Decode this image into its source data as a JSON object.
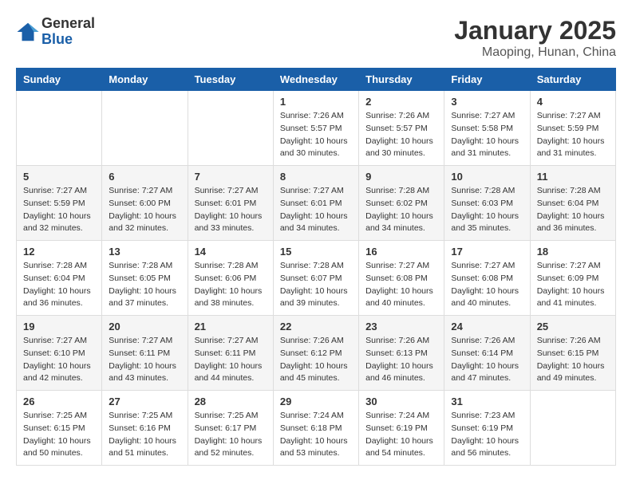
{
  "header": {
    "logo_general": "General",
    "logo_blue": "Blue",
    "month": "January 2025",
    "location": "Maoping, Hunan, China"
  },
  "weekdays": [
    "Sunday",
    "Monday",
    "Tuesday",
    "Wednesday",
    "Thursday",
    "Friday",
    "Saturday"
  ],
  "weeks": [
    [
      {
        "day": "",
        "sunrise": "",
        "sunset": "",
        "daylight": ""
      },
      {
        "day": "",
        "sunrise": "",
        "sunset": "",
        "daylight": ""
      },
      {
        "day": "",
        "sunrise": "",
        "sunset": "",
        "daylight": ""
      },
      {
        "day": "1",
        "sunrise": "Sunrise: 7:26 AM",
        "sunset": "Sunset: 5:57 PM",
        "daylight": "Daylight: 10 hours and 30 minutes."
      },
      {
        "day": "2",
        "sunrise": "Sunrise: 7:26 AM",
        "sunset": "Sunset: 5:57 PM",
        "daylight": "Daylight: 10 hours and 30 minutes."
      },
      {
        "day": "3",
        "sunrise": "Sunrise: 7:27 AM",
        "sunset": "Sunset: 5:58 PM",
        "daylight": "Daylight: 10 hours and 31 minutes."
      },
      {
        "day": "4",
        "sunrise": "Sunrise: 7:27 AM",
        "sunset": "Sunset: 5:59 PM",
        "daylight": "Daylight: 10 hours and 31 minutes."
      }
    ],
    [
      {
        "day": "5",
        "sunrise": "Sunrise: 7:27 AM",
        "sunset": "Sunset: 5:59 PM",
        "daylight": "Daylight: 10 hours and 32 minutes."
      },
      {
        "day": "6",
        "sunrise": "Sunrise: 7:27 AM",
        "sunset": "Sunset: 6:00 PM",
        "daylight": "Daylight: 10 hours and 32 minutes."
      },
      {
        "day": "7",
        "sunrise": "Sunrise: 7:27 AM",
        "sunset": "Sunset: 6:01 PM",
        "daylight": "Daylight: 10 hours and 33 minutes."
      },
      {
        "day": "8",
        "sunrise": "Sunrise: 7:27 AM",
        "sunset": "Sunset: 6:01 PM",
        "daylight": "Daylight: 10 hours and 34 minutes."
      },
      {
        "day": "9",
        "sunrise": "Sunrise: 7:28 AM",
        "sunset": "Sunset: 6:02 PM",
        "daylight": "Daylight: 10 hours and 34 minutes."
      },
      {
        "day": "10",
        "sunrise": "Sunrise: 7:28 AM",
        "sunset": "Sunset: 6:03 PM",
        "daylight": "Daylight: 10 hours and 35 minutes."
      },
      {
        "day": "11",
        "sunrise": "Sunrise: 7:28 AM",
        "sunset": "Sunset: 6:04 PM",
        "daylight": "Daylight: 10 hours and 36 minutes."
      }
    ],
    [
      {
        "day": "12",
        "sunrise": "Sunrise: 7:28 AM",
        "sunset": "Sunset: 6:04 PM",
        "daylight": "Daylight: 10 hours and 36 minutes."
      },
      {
        "day": "13",
        "sunrise": "Sunrise: 7:28 AM",
        "sunset": "Sunset: 6:05 PM",
        "daylight": "Daylight: 10 hours and 37 minutes."
      },
      {
        "day": "14",
        "sunrise": "Sunrise: 7:28 AM",
        "sunset": "Sunset: 6:06 PM",
        "daylight": "Daylight: 10 hours and 38 minutes."
      },
      {
        "day": "15",
        "sunrise": "Sunrise: 7:28 AM",
        "sunset": "Sunset: 6:07 PM",
        "daylight": "Daylight: 10 hours and 39 minutes."
      },
      {
        "day": "16",
        "sunrise": "Sunrise: 7:27 AM",
        "sunset": "Sunset: 6:08 PM",
        "daylight": "Daylight: 10 hours and 40 minutes."
      },
      {
        "day": "17",
        "sunrise": "Sunrise: 7:27 AM",
        "sunset": "Sunset: 6:08 PM",
        "daylight": "Daylight: 10 hours and 40 minutes."
      },
      {
        "day": "18",
        "sunrise": "Sunrise: 7:27 AM",
        "sunset": "Sunset: 6:09 PM",
        "daylight": "Daylight: 10 hours and 41 minutes."
      }
    ],
    [
      {
        "day": "19",
        "sunrise": "Sunrise: 7:27 AM",
        "sunset": "Sunset: 6:10 PM",
        "daylight": "Daylight: 10 hours and 42 minutes."
      },
      {
        "day": "20",
        "sunrise": "Sunrise: 7:27 AM",
        "sunset": "Sunset: 6:11 PM",
        "daylight": "Daylight: 10 hours and 43 minutes."
      },
      {
        "day": "21",
        "sunrise": "Sunrise: 7:27 AM",
        "sunset": "Sunset: 6:11 PM",
        "daylight": "Daylight: 10 hours and 44 minutes."
      },
      {
        "day": "22",
        "sunrise": "Sunrise: 7:26 AM",
        "sunset": "Sunset: 6:12 PM",
        "daylight": "Daylight: 10 hours and 45 minutes."
      },
      {
        "day": "23",
        "sunrise": "Sunrise: 7:26 AM",
        "sunset": "Sunset: 6:13 PM",
        "daylight": "Daylight: 10 hours and 46 minutes."
      },
      {
        "day": "24",
        "sunrise": "Sunrise: 7:26 AM",
        "sunset": "Sunset: 6:14 PM",
        "daylight": "Daylight: 10 hours and 47 minutes."
      },
      {
        "day": "25",
        "sunrise": "Sunrise: 7:26 AM",
        "sunset": "Sunset: 6:15 PM",
        "daylight": "Daylight: 10 hours and 49 minutes."
      }
    ],
    [
      {
        "day": "26",
        "sunrise": "Sunrise: 7:25 AM",
        "sunset": "Sunset: 6:15 PM",
        "daylight": "Daylight: 10 hours and 50 minutes."
      },
      {
        "day": "27",
        "sunrise": "Sunrise: 7:25 AM",
        "sunset": "Sunset: 6:16 PM",
        "daylight": "Daylight: 10 hours and 51 minutes."
      },
      {
        "day": "28",
        "sunrise": "Sunrise: 7:25 AM",
        "sunset": "Sunset: 6:17 PM",
        "daylight": "Daylight: 10 hours and 52 minutes."
      },
      {
        "day": "29",
        "sunrise": "Sunrise: 7:24 AM",
        "sunset": "Sunset: 6:18 PM",
        "daylight": "Daylight: 10 hours and 53 minutes."
      },
      {
        "day": "30",
        "sunrise": "Sunrise: 7:24 AM",
        "sunset": "Sunset: 6:19 PM",
        "daylight": "Daylight: 10 hours and 54 minutes."
      },
      {
        "day": "31",
        "sunrise": "Sunrise: 7:23 AM",
        "sunset": "Sunset: 6:19 PM",
        "daylight": "Daylight: 10 hours and 56 minutes."
      },
      {
        "day": "",
        "sunrise": "",
        "sunset": "",
        "daylight": ""
      }
    ]
  ]
}
